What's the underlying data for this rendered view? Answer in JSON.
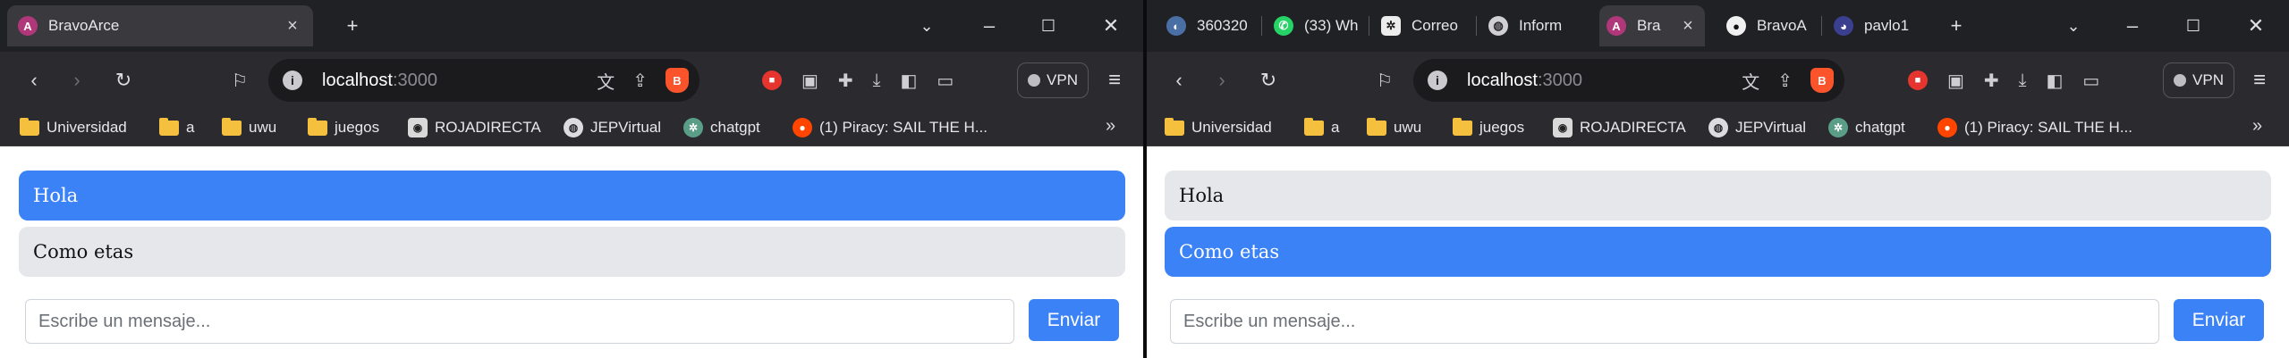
{
  "colors": {
    "self_message_bg": "#3b82f6",
    "other_message_bg": "#e5e7eb",
    "send_button_bg": "#3b82f6",
    "browser_chrome": "#2b2b2f",
    "tab_strip": "#202124"
  },
  "left_window": {
    "tabs": [
      {
        "title": "BravoArce",
        "icon": "chat-app-favicon",
        "active": true
      }
    ],
    "address": {
      "host": "localhost",
      "port": ":3000"
    },
    "chat": {
      "messages": [
        {
          "text": "Hola",
          "from": "self"
        },
        {
          "text": "Como etas",
          "from": "other"
        }
      ],
      "input_placeholder": "Escribe un mensaje...",
      "send_label": "Enviar"
    }
  },
  "right_window": {
    "tabs": [
      {
        "title": "360320",
        "icon": "user-avatar-favicon",
        "active": false
      },
      {
        "title": "(33) Wh",
        "icon": "whatsapp-icon",
        "active": false
      },
      {
        "title": "Correo",
        "icon": "chatgpt-icon",
        "active": false
      },
      {
        "title": "Inform",
        "icon": "globe-icon",
        "active": false
      },
      {
        "title": "Bra",
        "icon": "chat-app-favicon",
        "active": true
      },
      {
        "title": "BravoA",
        "icon": "github-icon",
        "active": false
      },
      {
        "title": "pavlo1",
        "icon": "app-favicon",
        "active": false
      }
    ],
    "address": {
      "host": "localhost",
      "port": ":3000"
    },
    "chat": {
      "messages": [
        {
          "text": "Hola",
          "from": "other"
        },
        {
          "text": "Como etas",
          "from": "self"
        }
      ],
      "input_placeholder": "Escribe un mensaje...",
      "send_label": "Enviar"
    }
  },
  "toolbar": {
    "vpn_label": "VPN",
    "new_tab": "+",
    "more": "»"
  },
  "bookmarks": [
    {
      "label": "Universidad",
      "icon": "folder-icon"
    },
    {
      "label": "a",
      "icon": "folder-icon"
    },
    {
      "label": "uwu",
      "icon": "folder-icon"
    },
    {
      "label": "juegos",
      "icon": "folder-icon"
    },
    {
      "label": "ROJADIRECTA",
      "icon": "site-icon"
    },
    {
      "label": "JEPVirtual",
      "icon": "globe-icon"
    },
    {
      "label": "chatgpt",
      "icon": "chatgpt-icon"
    },
    {
      "label": "(1) Piracy: SAIL THE H...",
      "icon": "reddit-icon"
    }
  ]
}
